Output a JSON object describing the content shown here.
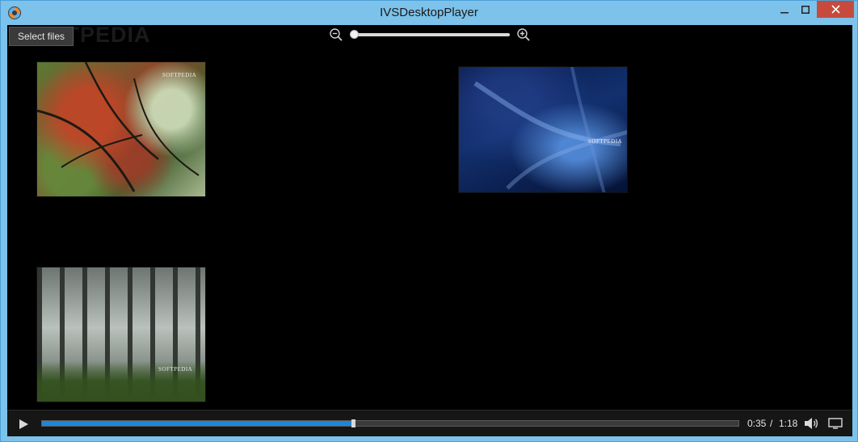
{
  "window": {
    "title": "IVSDesktopPlayer",
    "icons": {
      "app": "app-logo-icon",
      "minimize": "minimize-icon",
      "maximize": "maximize-icon",
      "close": "close-icon"
    }
  },
  "toolbar": {
    "select_files_label": "Select files",
    "watermark": "SOFTPEDIA",
    "zoom_out_icon": "zoom-out-icon",
    "zoom_in_icon": "zoom-in-icon",
    "zoom_level": 0.0
  },
  "thumbnails": [
    {
      "name": "autumn-leaves-thumbnail",
      "label": "SOFTPEDIA"
    },
    {
      "name": "blue-abstract-thumbnail",
      "label": "SOFTPEDIA"
    },
    {
      "name": "misty-forest-thumbnail",
      "label": "SOFTPEDIA"
    }
  ],
  "player": {
    "play_icon": "play-icon",
    "progress": 0.447,
    "current_time": "0:35",
    "separator": "/",
    "total_time": "1:18",
    "volume_icon": "volume-icon",
    "fullscreen_icon": "fullscreen-icon"
  },
  "colors": {
    "titlebar": "#7cc2ea",
    "close": "#c74b3c",
    "accent": "#1d86d8",
    "background": "#000000"
  }
}
